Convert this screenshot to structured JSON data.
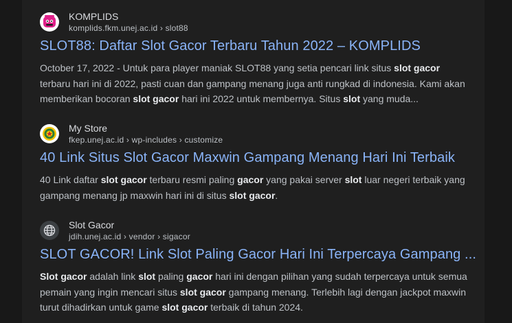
{
  "results": [
    {
      "site_name": "KOMPLIDS",
      "url": "komplids.fkm.unej.ac.id › slot88",
      "favicon_icon": "komplids-logo-icon",
      "title": "SLOT88: Daftar Slot Gacor Terbaru Tahun 2022 – KOMPLIDS",
      "snippet": [
        {
          "t": "October 17, 2022 - Untuk para player maniak SLOT88 yang setia pencari link situs ",
          "b": false
        },
        {
          "t": "slot gacor",
          "b": true
        },
        {
          "t": " terbaru hari ini di 2022, pasti cuan dan gampang menang juga anti rungkad di indonesia. Kami akan memberikan bocoran ",
          "b": false
        },
        {
          "t": "slot gacor",
          "b": true
        },
        {
          "t": " hari ini 2022 untuk membernya. Situs ",
          "b": false
        },
        {
          "t": "slot",
          "b": true
        },
        {
          "t": " yang muda...",
          "b": false
        }
      ]
    },
    {
      "site_name": "My Store",
      "url": "fkep.unej.ac.id › wp-includes › customize",
      "favicon_icon": "unej-emblem-icon",
      "title": "40 Link Situs Slot Gacor Maxwin Gampang Menang Hari Ini Terbaik",
      "snippet": [
        {
          "t": "40 Link daftar ",
          "b": false
        },
        {
          "t": "slot gacor",
          "b": true
        },
        {
          "t": " terbaru resmi paling ",
          "b": false
        },
        {
          "t": "gacor",
          "b": true
        },
        {
          "t": " yang pakai server ",
          "b": false
        },
        {
          "t": "slot",
          "b": true
        },
        {
          "t": " luar negeri terbaik yang gampang menang jp maxwin hari ini di situs ",
          "b": false
        },
        {
          "t": "slot gacor",
          "b": true
        },
        {
          "t": ".",
          "b": false
        }
      ]
    },
    {
      "site_name": "Slot Gacor",
      "url": "jdih.unej.ac.id › vendor › sigacor",
      "favicon_icon": "globe-icon",
      "title": "SLOT GACOR! Link Slot Paling Gacor Hari Ini Terpercaya Gampang ...",
      "snippet": [
        {
          "t": "Slot gacor",
          "b": true
        },
        {
          "t": " adalah link ",
          "b": false
        },
        {
          "t": "slot",
          "b": true
        },
        {
          "t": " paling ",
          "b": false
        },
        {
          "t": "gacor",
          "b": true
        },
        {
          "t": " hari ini dengan pilihan yang sudah terpercaya untuk semua pemain yang ingin mencari situs ",
          "b": false
        },
        {
          "t": "slot gacor",
          "b": true
        },
        {
          "t": " gampang menang. Terlebih lagi dengan jackpot maxwin turut dihadirkan untuk game ",
          "b": false
        },
        {
          "t": "slot gacor",
          "b": true
        },
        {
          "t": " terbaik di tahun 2024.",
          "b": false
        }
      ]
    }
  ],
  "colors": {
    "background": "#1f1f1f",
    "title_link": "#8ab4f8",
    "snippet_text": "#bdc1c6",
    "snippet_bold": "#e8eaed"
  }
}
